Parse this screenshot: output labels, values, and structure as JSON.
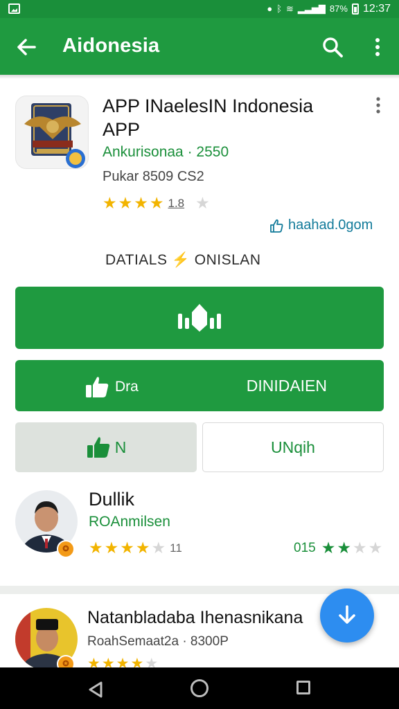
{
  "status_bar": {
    "wifi_glyph": "≋",
    "signal_glyph": "▂▃▅▇",
    "battery_text": "87%",
    "time": "12:37"
  },
  "app_bar": {
    "title": "Aidonesia",
    "back_icon": "arrow-left",
    "search_icon": "search",
    "more_icon": "more-vert"
  },
  "app": {
    "name": "APP INaelesIN Indonesia APP",
    "developer": "Ankurisonaa · 2550",
    "meta": "Pukar 8509 CS2",
    "rating_stars": 4,
    "rating_count": "1.8",
    "link_text": "haahad.0gom"
  },
  "tabs_label": "DATIALS ⚡ ONISLAN",
  "buttons": {
    "secondary_left": "Dra",
    "secondary_right": "DINIDAIEN",
    "toggle_a": "N",
    "toggle_b": "UNqih"
  },
  "reviews": [
    {
      "name": "Dullik",
      "sub": "ROAnmilsen",
      "stars": 4,
      "count": "11",
      "score": "015",
      "score_stars": 2
    },
    {
      "name": "Natanbladaba Ihenasnikana",
      "sub": "RoahSemaat2a · 8300P",
      "stars": 4
    }
  ],
  "colors": {
    "primary": "#1f9a40",
    "accent": "#2d8df0",
    "star": "#f2b400"
  }
}
